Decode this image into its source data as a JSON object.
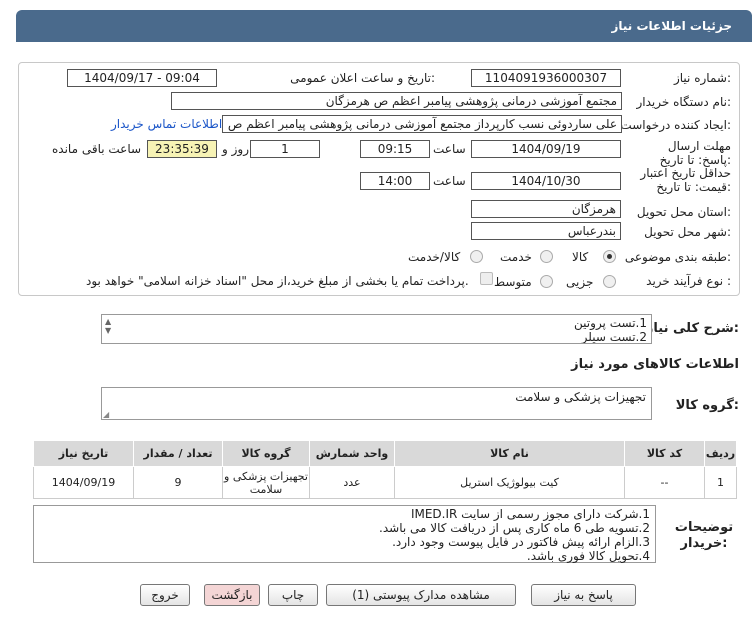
{
  "header": {
    "title": "جزئیات اطلاعات نیاز"
  },
  "watermark": {
    "text": "AriaTender.net"
  },
  "form": {
    "need_number_label": "شماره نیاز:",
    "need_number": "1104091936000307",
    "announce_label": "تاریخ و ساعت اعلان عمومی:",
    "announce_value": "1404/09/17 - 09:04",
    "buyer_org_label": "نام دستگاه خریدار:",
    "buyer_org": "مجتمع آموزشی درمانی پژوهشی پیامبر اعظم ص  هرمزگان",
    "requester_label": "ایجاد کننده درخواست:",
    "requester": "علی ساردوئی نسب کارپرداز مجتمع آموزشی درمانی پژوهشی پیامبر اعظم ص",
    "contact_link": "اطلاعات تماس خریدار",
    "reply_deadline_label": "مهلت ارسال پاسخ: تا تاریخ:",
    "reply_date": "1404/09/19",
    "time_label": "ساعت",
    "reply_time": "09:15",
    "day_count": "1",
    "day_and_label": "روز و",
    "remaining_time": "23:35:39",
    "remaining_label": "ساعت باقی مانده",
    "validity_label": "حداقل تاریخ اعتبار قیمت: تا تاریخ:",
    "validity_date": "1404/10/30",
    "validity_time": "14:00",
    "province_label": "استان محل تحویل:",
    "province": "هرمزگان",
    "city_label": "شهر محل تحویل:",
    "city": "بندرعباس",
    "category_label": "طبقه بندی موضوعی:",
    "category_options": [
      "کالا",
      "خدمت",
      "کالا/خدمت"
    ],
    "process_label": "نوع فرآیند خرید :",
    "process_options": [
      "جزیی",
      "متوسط"
    ],
    "payment_note": "پرداخت تمام یا بخشی از مبلغ خرید،از محل \"اسناد خزانه اسلامی\" خواهد بود."
  },
  "description": {
    "label": "شرح کلی نیاز:",
    "lines": [
      "1.تست پروتین",
      "2.تست سیلر"
    ]
  },
  "goods": {
    "section_title": "اطلاعات کالاهای مورد نیاز",
    "group_label": "گروه کالا:",
    "group_value": "تجهیزات پزشکی و سلامت"
  },
  "table": {
    "headers": [
      "ردیف",
      "کد کالا",
      "نام کالا",
      "واحد شمارش",
      "گروه کالا",
      "تعداد / مقدار",
      "تاریخ نیاز"
    ],
    "rows": [
      [
        "1",
        "--",
        "کیت بیولوژیک استریل",
        "عدد",
        "تجهیزات پزشکی و سلامت",
        "9",
        "1404/09/19"
      ]
    ]
  },
  "notes": {
    "label": "توضیحات خریدار:",
    "lines": [
      "1.شرکت دارای مجوز رسمی از سایت IMED.IR",
      "2.تسویه طی 6 ماه  کاری پس از دریافت کالا می باشد.",
      "3.الزام ارائه پیش فاکتور در فایل پیوست وجود دارد.",
      "4.تحویل کالا فوری باشد."
    ]
  },
  "buttons": {
    "reply": "پاسخ به نیاز",
    "attachments": "مشاهده مدارک پیوستی (1)",
    "print": "چاپ",
    "back": "بازگشت",
    "exit": "خروج"
  }
}
